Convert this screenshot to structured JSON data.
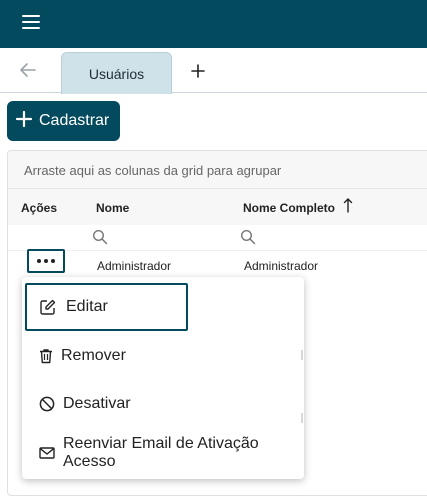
{
  "tabs": [
    {
      "label": "Usuários"
    }
  ],
  "toolbar": {
    "add_label": "Cadastrar"
  },
  "grid": {
    "group_hint": "Arraste aqui as colunas da grid para agrupar",
    "columns": [
      {
        "label": "Ações"
      },
      {
        "label": "Nome"
      },
      {
        "label": "Nome Completo",
        "sort": "ascending"
      }
    ],
    "rows": [
      {
        "nome": "Administrador",
        "nome_completo": "Administrador"
      }
    ]
  },
  "context_menu": {
    "items": [
      {
        "label": "Editar",
        "icon": "edit-icon"
      },
      {
        "label": "Remover",
        "icon": "trash-icon"
      },
      {
        "label": "Desativar",
        "icon": "block-icon"
      },
      {
        "label": "Reenviar Email de Ativação Acesso",
        "icon": "mail-icon"
      }
    ]
  },
  "colors": {
    "brand": "#034a5e",
    "tab_active": "#cfe2ea"
  }
}
